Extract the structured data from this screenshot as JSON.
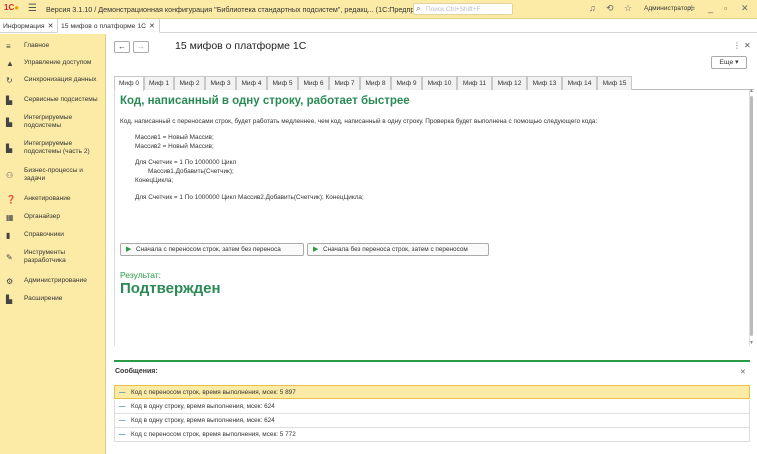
{
  "topbar": {
    "logo": "1С",
    "title": "Версия 3.1.10 / Демонстрационная конфигурация \"Библиотека стандартных подсистем\", редакц...  (1С:Предприятие)",
    "search_placeholder": "Поиск Ctrl+Shift+F",
    "user": "Администратор"
  },
  "window_tabs": [
    {
      "label": "Информация"
    },
    {
      "label": "15 мифов о платформе 1С"
    }
  ],
  "sidebar": {
    "items": [
      {
        "label": "Главное",
        "icon": "menu-icon"
      },
      {
        "label": "Управление доступом",
        "icon": "lock-icon"
      },
      {
        "label": "Синхронизация данных",
        "icon": "sync-icon"
      },
      {
        "label": "Сервисные подсистемы",
        "icon": "chart-icon"
      },
      {
        "label": "Интегрируемые подсистемы",
        "icon": "chart-icon"
      },
      {
        "label": "Интегрируемые подсистемы (часть 2)",
        "icon": "chart-icon"
      },
      {
        "label": "Бизнес-процессы и задачи",
        "icon": "people-icon"
      },
      {
        "label": "Анкетирование",
        "icon": "question-icon"
      },
      {
        "label": "Органайзер",
        "icon": "calendar-icon"
      },
      {
        "label": "Справочники",
        "icon": "book-icon"
      },
      {
        "label": "Инструменты разработчика",
        "icon": "wrench-icon"
      },
      {
        "label": "Администрирование",
        "icon": "gear-icon"
      },
      {
        "label": "Расширение",
        "icon": "chart-icon"
      }
    ]
  },
  "page": {
    "title": "15 мифов о платформе 1С",
    "more_button": "Еще ▾"
  },
  "myth_tabs": [
    "Миф 0",
    "Миф 1",
    "Миф 2",
    "Миф 3",
    "Миф 4",
    "Миф 5",
    "Миф 6",
    "Миф 7",
    "Миф 8",
    "Миф 9",
    "Миф 10",
    "Миф 11",
    "Миф 12",
    "Миф 13",
    "Миф 14",
    "Миф 15"
  ],
  "myth": {
    "heading": "Код, написанный в одну строку, работает быстрее",
    "description": "Код, написанный с переносами строк, будет работать медленнее, чем код, написанный в одну строку. Проверка будет выполнена с помощью следующего кода:",
    "code_lines": [
      "Массив1 = Новый Массив;",
      "Массив2 = Новый Массив;",
      "Для Счетчик = 1 По 1000000 Цикл",
      "Массив1.Добавить(Счетчик);",
      "КонецЦикла;",
      "Для Счетчик = 1 По 1000000 Цикл Массив2.Добавить(Счетчик); КонецЦикла;"
    ],
    "button1": "Сначала с переносом строк, затем без переноса",
    "button2": "Сначала без переноса строк, затем с переносом",
    "result_label": "Результат:",
    "result_value": "Подтвержден"
  },
  "messages": {
    "header": "Сообщения:",
    "items": [
      "Код с переносом строк, время выполнения, мсек: 5 897",
      "Код в одну строку, время выполнения, мсек: 624",
      "Код в одну строку, время выполнения, мсек: 624",
      "Код с переносом строк, время выполнения, мсек: 5 772"
    ]
  }
}
